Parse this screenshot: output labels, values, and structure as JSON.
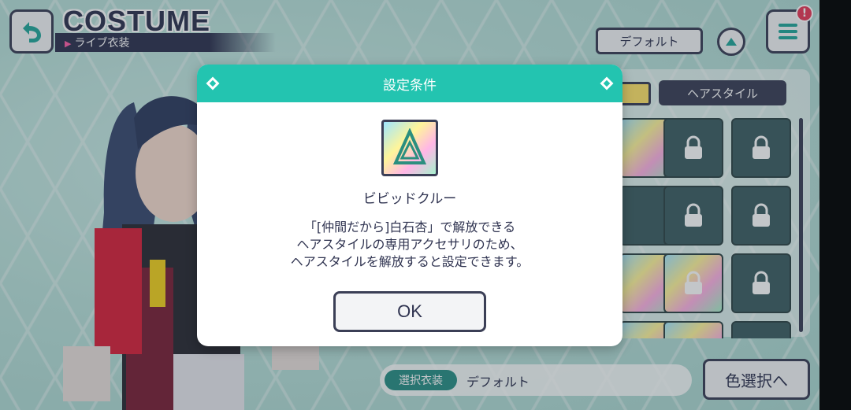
{
  "header": {
    "title_en": "COSTUME",
    "title_ja": "ライブ衣装"
  },
  "toolbar": {
    "default_label": "デフォルト"
  },
  "badge": {
    "text": "!"
  },
  "panel": {
    "tab_hair": "ヘアスタイル"
  },
  "bottom": {
    "label": "選択衣装",
    "value": "デフォルト",
    "color_button": "色選択へ"
  },
  "dialog": {
    "title": "設定条件",
    "item_name": "ビビッドクルー",
    "desc_line1": "「[仲間だから]白石杏」で解放できる",
    "desc_line2": "ヘアスタイルの専用アクセサリのため、",
    "desc_line3": "ヘアスタイルを解放すると設定できます。",
    "ok_label": "OK"
  },
  "colors": {
    "accent": "#23c4b0",
    "dark": "#3b3f56",
    "badge": "#e83a58"
  },
  "icons": [
    "back-arrow-icon",
    "menu-icon",
    "chevron-up-icon",
    "lock-icon",
    "crew-logo-icon"
  ]
}
